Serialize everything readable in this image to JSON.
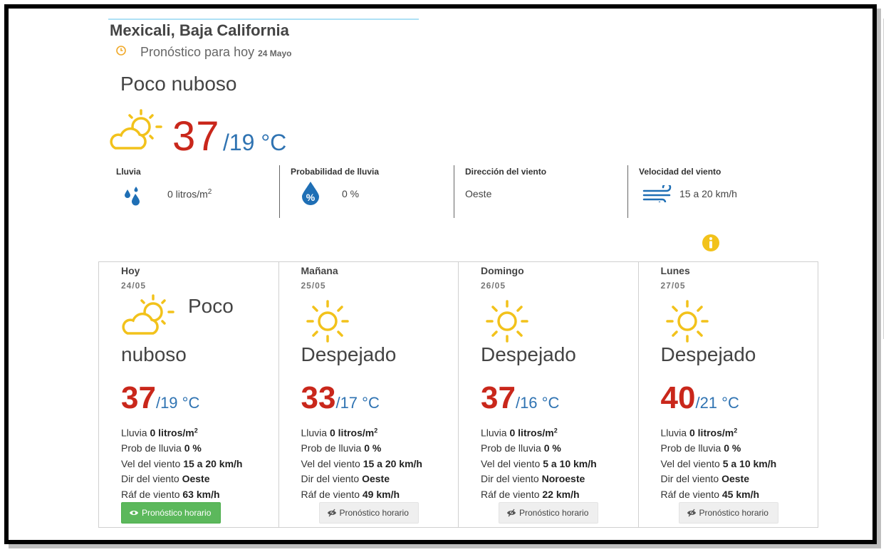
{
  "header": {
    "city": "Mexicali, Baja California",
    "subtitle": "Pronóstico para hoy",
    "date": "24 Mayo"
  },
  "today": {
    "condition": "Poco nuboso",
    "tmax": "37",
    "tmin": "/19 °C",
    "icon": "partly-cloudy-icon",
    "metrics": {
      "rain": {
        "label": "Lluvia",
        "value": "0 litros/m",
        "sup": "2",
        "icon": "raindrops-icon"
      },
      "prob": {
        "label": "Probabilidad de lluvia",
        "value": "0 %",
        "icon": "percent-drop-icon"
      },
      "dir": {
        "label": "Dirección del viento",
        "value": "Oeste"
      },
      "speed": {
        "label": "Velocidad del viento",
        "value": "15 a 20 km/h",
        "icon": "wind-icon"
      }
    }
  },
  "labels": {
    "rain": "Lluvia",
    "prob": "Prob de lluvia",
    "speed": "Vel del viento",
    "dir": "Dir del viento",
    "gust": "Ráf de viento",
    "unit_sq": "2"
  },
  "days": [
    {
      "name": "Hoy",
      "date": "24/05",
      "condition_top": "Poco",
      "condition": "nuboso",
      "icon": "partly-cloudy-icon",
      "tmax": "37",
      "tmin": "/19 °C",
      "rain": "0 litros/m",
      "prob": "0 %",
      "speed": "15 a 20 km/h",
      "dir": "Oeste",
      "gust": "63 km/h",
      "button": "Pronóstico horario",
      "active": true
    },
    {
      "name": "Mañana",
      "date": "25/05",
      "condition_top": "",
      "condition": "Despejado",
      "icon": "sun-icon",
      "tmax": "33",
      "tmin": "/17 °C",
      "rain": "0 litros/m",
      "prob": "0 %",
      "speed": "15 a 20 km/h",
      "dir": "Oeste",
      "gust": "49 km/h",
      "button": "Pronóstico horario",
      "active": false
    },
    {
      "name": "Domingo",
      "date": "26/05",
      "condition_top": "",
      "condition": "Despejado",
      "icon": "sun-icon",
      "tmax": "37",
      "tmin": "/16 °C",
      "rain": "0 litros/m",
      "prob": "0 %",
      "speed": "5 a 10 km/h",
      "dir": "Noroeste",
      "gust": "22 km/h",
      "button": "Pronóstico horario",
      "active": false
    },
    {
      "name": "Lunes",
      "date": "27/05",
      "condition_top": "",
      "condition": "Despejado",
      "icon": "sun-icon",
      "tmax": "40",
      "tmin": "/21 °C",
      "rain": "0 litros/m",
      "prob": "0 %",
      "speed": "5 a 10 km/h",
      "dir": "Oeste",
      "gust": "45 km/h",
      "button": "Pronóstico horario",
      "active": false
    }
  ],
  "colors": {
    "max": "#c9271b",
    "min": "#2f73b2",
    "sun": "#f2c21b",
    "button_active": "#5cb85c",
    "icon_blue": "#1f6fb5"
  }
}
